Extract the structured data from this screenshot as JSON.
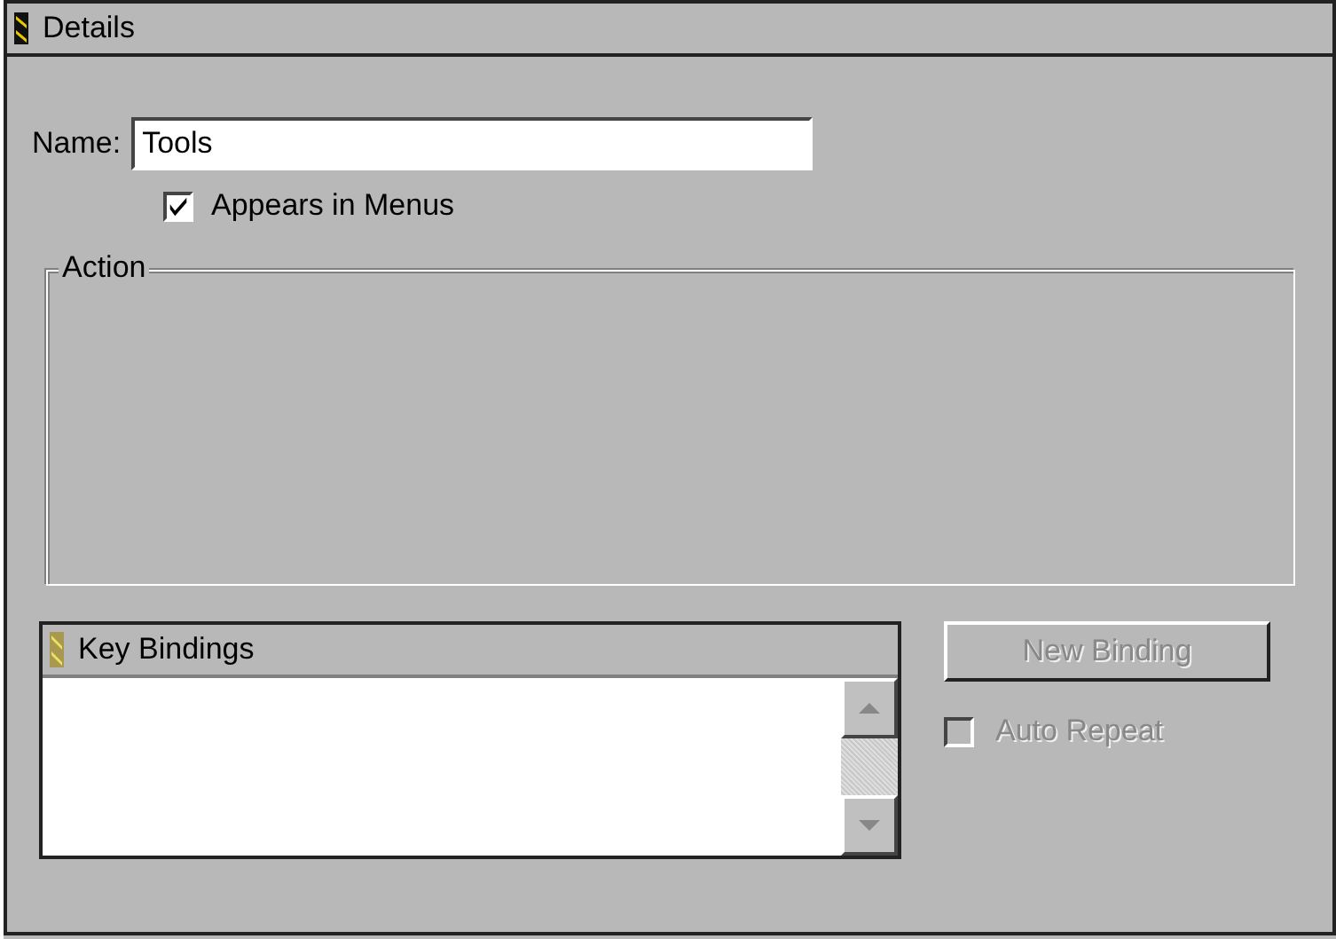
{
  "panel": {
    "title": "Details"
  },
  "name_field": {
    "label": "Name:",
    "value": "Tools"
  },
  "appears_in_menus": {
    "label": "Appears in Menus",
    "checked": true
  },
  "action_group": {
    "title": "Action"
  },
  "key_bindings": {
    "title": "Key Bindings"
  },
  "new_binding_button": {
    "label": "New Binding",
    "disabled": true
  },
  "auto_repeat": {
    "label": "Auto Repeat",
    "checked": false,
    "disabled": true
  }
}
